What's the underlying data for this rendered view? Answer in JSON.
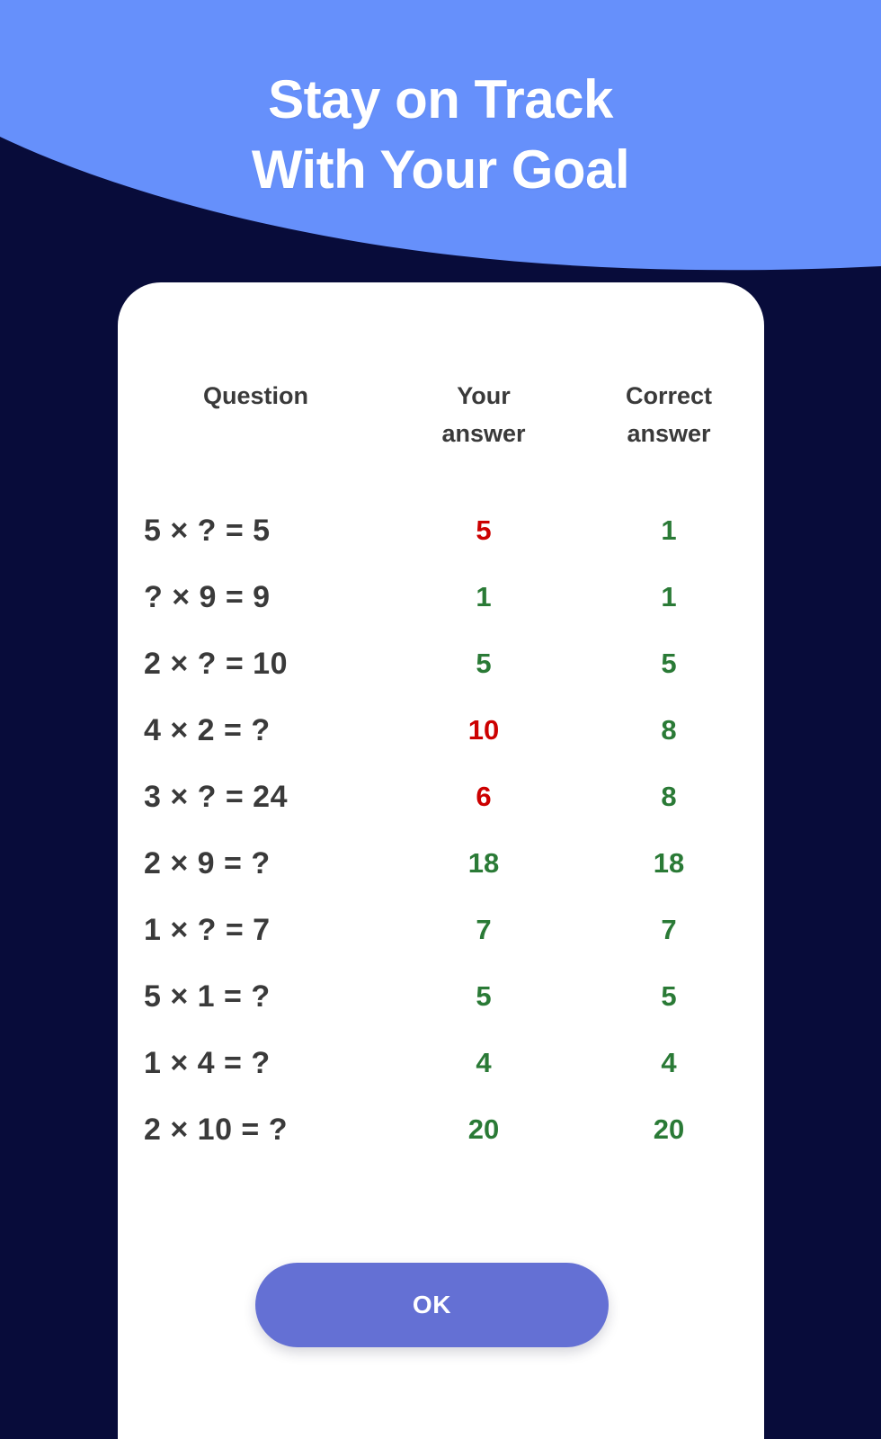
{
  "header": {
    "title_line1": "Stay on Track",
    "title_line2": "With Your Goal"
  },
  "colors": {
    "header_blue": "#6690fb",
    "background_navy": "#080c3a",
    "card_white": "#ffffff",
    "button_purple": "#6470d4",
    "wrong_red": "#cc0000",
    "right_green": "#2a7a36",
    "text_dark": "#3a3a3a"
  },
  "dialog": {
    "table": {
      "headers": {
        "question": "Question",
        "your_answer_line1": "Your",
        "your_answer_line2": "answer",
        "correct_answer_line1": "Correct",
        "correct_answer_line2": "answer"
      },
      "rows": [
        {
          "question": "5 × ? = 5",
          "your_answer": "5",
          "your_status": "wrong",
          "correct_answer": "1"
        },
        {
          "question": "? × 9 = 9",
          "your_answer": "1",
          "your_status": "right",
          "correct_answer": "1"
        },
        {
          "question": "2 × ? = 10",
          "your_answer": "5",
          "your_status": "right",
          "correct_answer": "5"
        },
        {
          "question": "4 × 2 = ?",
          "your_answer": "10",
          "your_status": "wrong",
          "correct_answer": "8"
        },
        {
          "question": "3 × ? = 24",
          "your_answer": "6",
          "your_status": "wrong",
          "correct_answer": "8"
        },
        {
          "question": "2 × 9 = ?",
          "your_answer": "18",
          "your_status": "right",
          "correct_answer": "18"
        },
        {
          "question": "1 × ? = 7",
          "your_answer": "7",
          "your_status": "right",
          "correct_answer": "7"
        },
        {
          "question": "5 × 1 = ?",
          "your_answer": "5",
          "your_status": "right",
          "correct_answer": "5"
        },
        {
          "question": "1 × 4 = ?",
          "your_answer": "4",
          "your_status": "right",
          "correct_answer": "4"
        },
        {
          "question": "2 × 10 = ?",
          "your_answer": "20",
          "your_status": "right",
          "correct_answer": "20"
        }
      ]
    },
    "ok_label": "OK"
  }
}
